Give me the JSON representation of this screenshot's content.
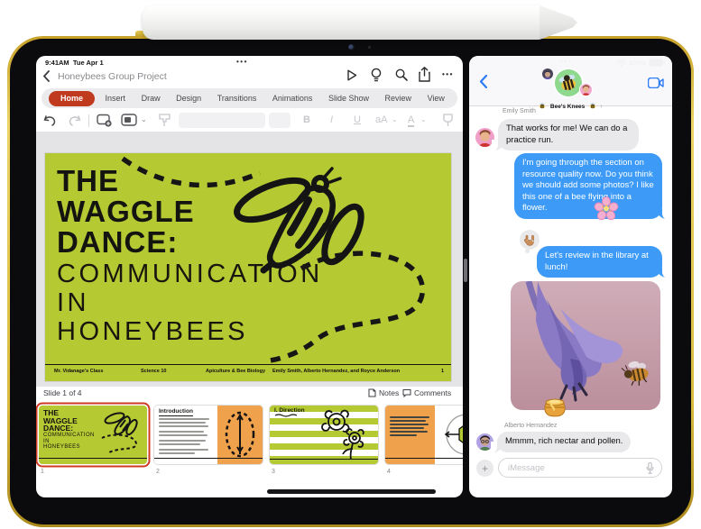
{
  "device": {
    "status_left": {
      "time": "9:41AM",
      "date": "Tue Apr 1"
    },
    "status_right": {
      "battery_percent": "100%"
    }
  },
  "keynote": {
    "nav": {
      "title": "Honeybees Group Project"
    },
    "tabs": [
      {
        "label": "Home",
        "active": true
      },
      {
        "label": "Insert"
      },
      {
        "label": "Draw"
      },
      {
        "label": "Design"
      },
      {
        "label": "Transitions"
      },
      {
        "label": "Animations"
      },
      {
        "label": "Slide Show"
      },
      {
        "label": "Review"
      },
      {
        "label": "View"
      }
    ],
    "toolbar": {
      "bold": "B",
      "italic": "I",
      "underline": "U",
      "text_size": "aA",
      "text_color": "A"
    },
    "slide": {
      "title_lines": [
        "THE",
        "WAGGLE",
        "DANCE:"
      ],
      "subtitle_lines": [
        "COMMUNICATION",
        "IN",
        "HONEYBEES"
      ],
      "footer": {
        "teacher": "Mr. Vidanage's Class",
        "course": "Science 10",
        "subject": "Apiculture & Bee Biology",
        "authors": "Emily Smith, Alberto Hernandez, and Royce Anderson",
        "page": "1"
      }
    },
    "status_text": "Slide 1 of 4",
    "notes_label": "Notes",
    "comments_label": "Comments",
    "thumbnails": [
      {
        "number": "1"
      },
      {
        "number": "2",
        "title": "Introduction"
      },
      {
        "number": "3",
        "title": "I. Direction"
      },
      {
        "number": "4"
      }
    ]
  },
  "messages": {
    "chat_title": "Bee's Knees",
    "title_chevron": "›",
    "conversation": [
      {
        "sender": "Emily Smith",
        "type": "received",
        "text": "That works for me! We can do a practice run."
      },
      {
        "type": "sent",
        "text": "I'm going through the section on resource quality now. Do you think we should add some photos? I like this one of a bee flying into a flower.",
        "sticker": "cherry-blossom"
      },
      {
        "type": "sent",
        "text": "Let's review in the library at lunch!",
        "tapback": "love-you-gesture"
      },
      {
        "type": "sent-photo",
        "description_sticker": "honey-pot"
      },
      {
        "sender": "Alberto Hernandez",
        "type": "received",
        "text": "Mmmm, rich nectar and pollen."
      }
    ],
    "input_placeholder": "iMessage"
  },
  "colors": {
    "ipad_gold": "#d9ba3e",
    "keynote_accent": "#c03a1f",
    "slide_green": "#b5c933",
    "thumbnail_orange": "#f0a14b",
    "imessage_blue": "#3d9bf7",
    "received_gray": "#e9e9eb"
  }
}
